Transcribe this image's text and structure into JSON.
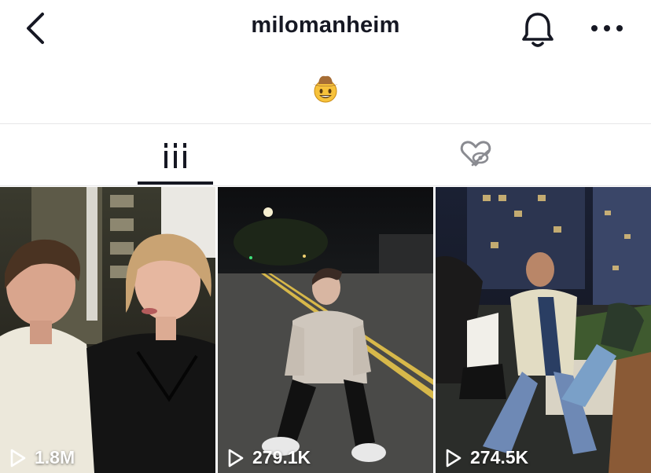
{
  "header": {
    "username": "milomanheim",
    "back_icon": "chevron-left-icon",
    "bell_icon": "bell-icon",
    "more_icon": "more-horizontal-icon"
  },
  "bio": {
    "emoji": "cowboy-hat-face-emoji"
  },
  "tabs": [
    {
      "name": "videos",
      "icon": "grid-icon",
      "selected": true
    },
    {
      "name": "liked",
      "icon": "liked-hidden-heart-icon",
      "selected": false
    }
  ],
  "videos": [
    {
      "views": "1.8M",
      "description": "two people posing for a selfie at night"
    },
    {
      "views": "279.1K",
      "description": "person crouching on a street at night"
    },
    {
      "views": "274.5K",
      "description": "people dancing on a rooftop at night"
    }
  ],
  "colors": {
    "text": "#161823",
    "divider": "#e6e6e8",
    "icon_gray": "#8a8b91"
  }
}
